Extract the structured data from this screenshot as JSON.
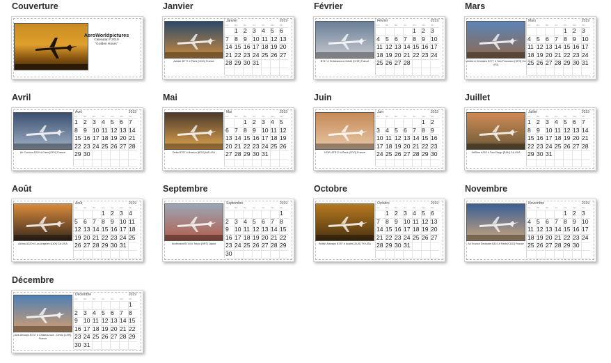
{
  "page": {
    "background": "#ffffff"
  },
  "weekday_labels": [
    "Lun",
    "Mar",
    "Mer",
    "Jeu",
    "Ven",
    "Sam",
    "Dim"
  ],
  "cover": {
    "title": "Couverture",
    "brand": "AeroWorldpictures",
    "line1": "Calendar # 2019",
    "line2": "\"Golden Hours\""
  },
  "months": [
    {
      "title": "Janvier",
      "header": "Janvier",
      "year": "2019",
      "start": 1,
      "days": 31,
      "caption": "Aviatie B777 # Paris [CDG] France",
      "colors": [
        "#2c4a6b",
        "#c98a3e"
      ]
    },
    {
      "title": "Février",
      "header": "Février",
      "year": "2019",
      "start": 4,
      "days": 28,
      "caption": "B747 # Châteauroux Déols [CHR] France",
      "colors": [
        "#6a7f98",
        "#c7c9cf"
      ]
    },
    {
      "title": "Mars",
      "header": "Mars",
      "year": "2019",
      "start": 4,
      "days": 31,
      "caption": "United & Emirates B777 # San Francisco [SFO] CA USA",
      "colors": [
        "#5d84b8",
        "#8c6a4f"
      ]
    },
    {
      "title": "Avril",
      "header": "Avril",
      "year": "2019",
      "start": 0,
      "days": 30,
      "caption": "Air Corsica A320 # Paris [ORY] France",
      "colors": [
        "#3b4f71",
        "#9fb0c4"
      ]
    },
    {
      "title": "Mai",
      "header": "Mai",
      "year": "2019",
      "start": 2,
      "days": 31,
      "caption": "Delta B757 # Boston [BOS] MA USA",
      "colors": [
        "#4b3a2c",
        "#e0a44e"
      ]
    },
    {
      "title": "Juin",
      "header": "Juin",
      "year": "2019",
      "start": 5,
      "days": 30,
      "caption": "HOP! ATR72 # Paris [CDG] France",
      "colors": [
        "#c78a58",
        "#e6c7a6"
      ]
    },
    {
      "title": "Juillet",
      "header": "Juillet",
      "year": "2019",
      "start": 0,
      "days": 31,
      "caption": "JetBlue A320 # San Diego [SAN] CA USA",
      "colors": [
        "#d08a53",
        "#6b5a3a"
      ]
    },
    {
      "title": "Août",
      "header": "Août",
      "year": "2019",
      "start": 3,
      "days": 31,
      "caption": "Airbus A320 # Los Angeles [LAX] CA USA",
      "colors": [
        "#d98b3b",
        "#3a2a1e"
      ]
    },
    {
      "title": "Septembre",
      "header": "Septembre",
      "year": "2019",
      "start": 6,
      "days": 30,
      "caption": "Northwest B744 # Tokyo [NRT] Japan",
      "colors": [
        "#9aa6b5",
        "#b35d4b"
      ]
    },
    {
      "title": "Octobre",
      "header": "Octobre",
      "year": "2019",
      "start": 1,
      "days": 31,
      "caption": "British Airways B787 # Austin [AUS] TX USA",
      "colors": [
        "#b7791f",
        "#4a3310"
      ]
    },
    {
      "title": "Novembre",
      "header": "Novembre",
      "year": "2019",
      "start": 4,
      "days": 30,
      "caption": "Air France Dedicate A319 # Paris [CDG] France",
      "colors": [
        "#3b5f96",
        "#c7a37c"
      ]
    },
    {
      "title": "Décembre",
      "header": "Décembre",
      "year": "2019",
      "start": 6,
      "days": 31,
      "caption": "Avis Airways B737 # Châteauroux - Déols [CHR] France",
      "colors": [
        "#4f7fb5",
        "#d29d6e"
      ]
    }
  ]
}
